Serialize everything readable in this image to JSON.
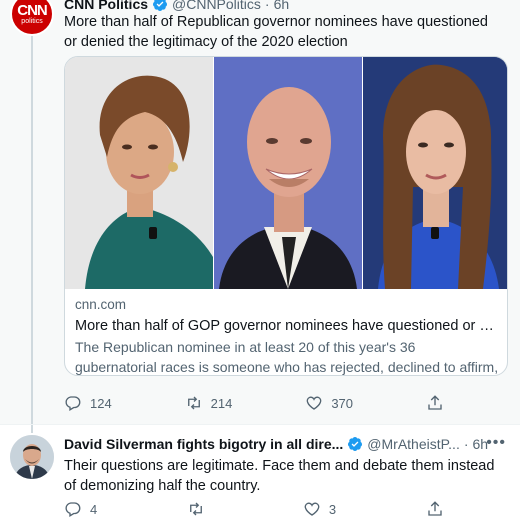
{
  "tweet1": {
    "display_name": "CNN Politics",
    "handle": "@CNNPolitics",
    "separator": "·",
    "time": "6h",
    "avatar_logo": "CNN",
    "avatar_sub": "politics",
    "text": "More than half of Republican governor nominees have questioned or denied the legitimacy of the 2020 election",
    "card": {
      "domain": "cnn.com",
      "title": "More than half of GOP governor nominees have questioned or denie...",
      "description": "The Republican nominee in at least 20 of this year's 36 gubernatorial races is someone who has rejected, declined to affirm, raised doubt..."
    },
    "actions": {
      "replies": "124",
      "retweets": "214",
      "likes": "370"
    }
  },
  "tweet2": {
    "display_name": "David Silverman fights bigotry in all dire...",
    "handle": "@MrAtheistP...",
    "separator": "·",
    "time": "6h",
    "text": "Their questions are legitimate.  Face them and debate them instead of demonizing half the country.",
    "actions": {
      "replies": "4",
      "retweets": "",
      "likes": "3"
    }
  },
  "icons": {
    "verified": "verified-badge-icon",
    "more": "more-icon",
    "reply": "reply-icon",
    "retweet": "retweet-icon",
    "like": "heart-icon",
    "share": "share-icon"
  },
  "colors": {
    "verified": "#1d9bf0",
    "cnn_red": "#cc0000",
    "secondary_text": "#536471"
  }
}
